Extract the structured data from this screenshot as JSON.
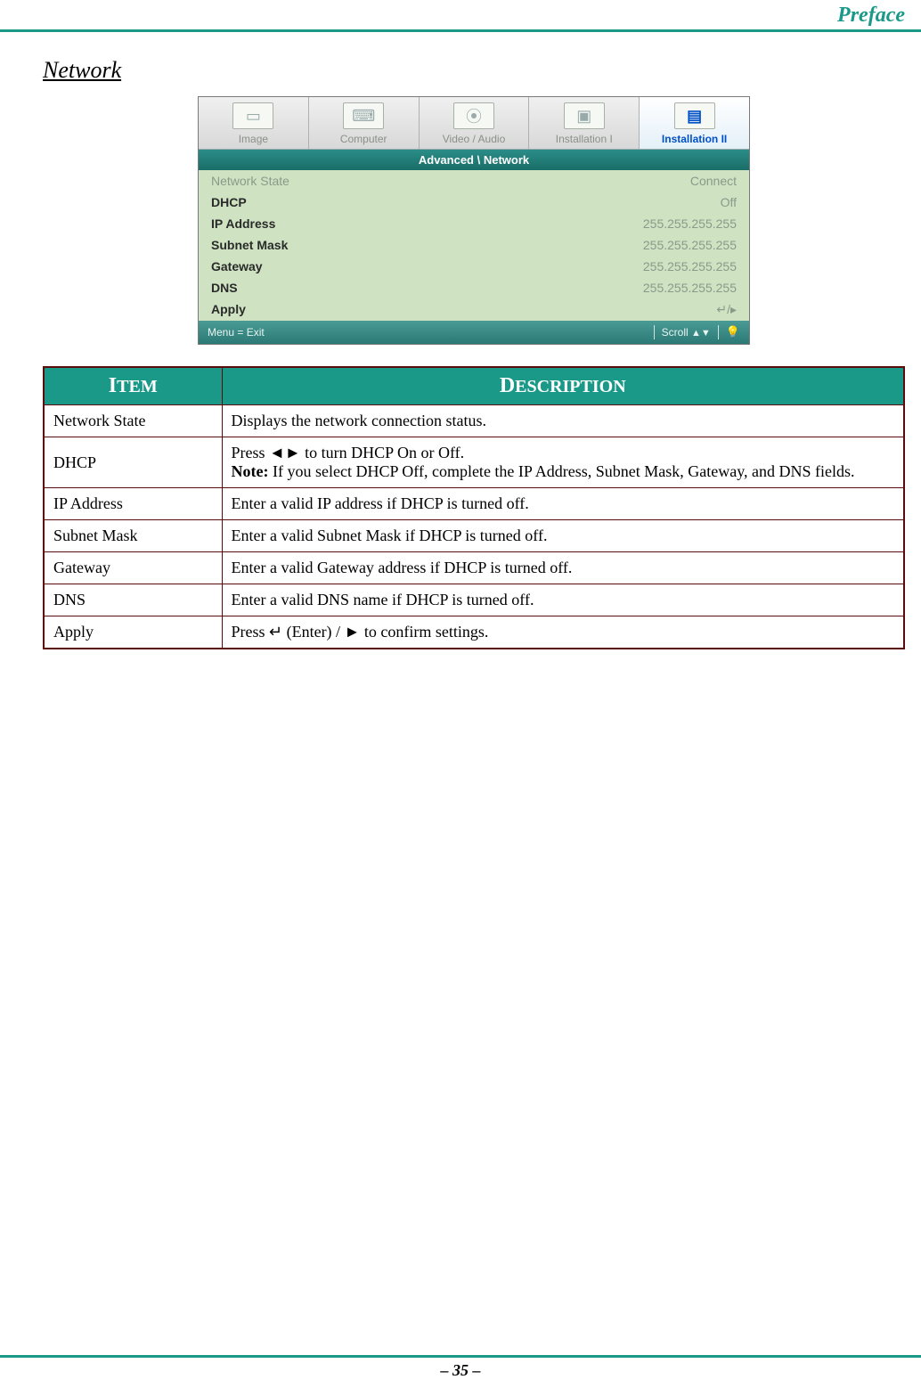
{
  "header": {
    "title": "Preface"
  },
  "section": {
    "heading": "Network"
  },
  "osd": {
    "tabs": [
      {
        "label": "Image",
        "icon": "▭"
      },
      {
        "label": "Computer",
        "icon": "⌨"
      },
      {
        "label": "Video / Audio",
        "icon": "⦿"
      },
      {
        "label": "Installation I",
        "icon": "▣"
      },
      {
        "label": "Installation II",
        "icon": "▤"
      }
    ],
    "path": "Advanced \\ Network",
    "rows": [
      {
        "label": "Network State",
        "value": "Connect",
        "dim": true
      },
      {
        "label": "DHCP",
        "value": "Off"
      },
      {
        "label": "IP Address",
        "value": "255.255.255.255"
      },
      {
        "label": "Subnet Mask",
        "value": "255.255.255.255"
      },
      {
        "label": "Gateway",
        "value": "255.255.255.255"
      },
      {
        "label": "DNS",
        "value": "255.255.255.255"
      },
      {
        "label": "Apply",
        "value": "↵/▸"
      }
    ],
    "footer": {
      "menu": "Menu = Exit",
      "scroll": "Scroll"
    }
  },
  "table": {
    "headers": {
      "item": "Item",
      "desc": "Description"
    },
    "rows": [
      {
        "item": "Network State",
        "desc": "Displays the network connection status."
      },
      {
        "item": "DHCP",
        "desc_line1": "Press ◄► to turn DHCP On or Off.",
        "note_label": "Note:",
        "note_text": " If you select DHCP Off, complete the IP Address, Subnet Mask, Gateway, and DNS fields."
      },
      {
        "item": "IP Address",
        "desc": "Enter a valid IP address if DHCP is turned off."
      },
      {
        "item": "Subnet Mask",
        "desc": "Enter a valid Subnet Mask if DHCP is turned off."
      },
      {
        "item": "Gateway",
        "desc": "Enter a valid Gateway address if DHCP is turned off."
      },
      {
        "item": "DNS",
        "desc": "Enter a valid DNS name if DHCP is turned off."
      },
      {
        "item": "Apply",
        "desc": "Press ↵ (Enter) / ► to confirm settings."
      }
    ]
  },
  "footer": {
    "page": "– 35 –"
  }
}
